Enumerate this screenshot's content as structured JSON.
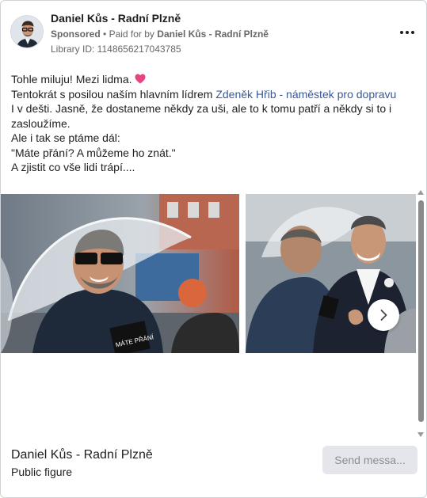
{
  "ad": {
    "advertiser_name": "Daniel Kůs - Radní Plzně",
    "sponsored_label": "Sponsored",
    "separator": "•",
    "paid_for_prefix": "Paid for by",
    "paid_for_name": "Daniel Kůs - Radní Plzně",
    "library_id": "Library ID: 1148656217043785",
    "more_icon": "more-options-icon"
  },
  "body": {
    "line1": "Tohle miluju! Mezi lidma.",
    "line2_prefix": "Tentokrát s posilou naším hlavním lídrem",
    "line2_link": "Zdeněk Hřib - náměstek pro dopravu",
    "line3": "I v dešti. Jasně, že dostaneme někdy za uši, ale to k tomu patří a někdy si to i",
    "line4": "zasloužíme.",
    "line5": "Ale i tak se ptáme dál:",
    "line6": "\"Máte přání? A můžeme ho znát.\"",
    "line7": "A zjistit co vše lidi trápí...."
  },
  "carousel": {
    "slide1_sign": "MÁTE PŘÁNÍ",
    "next_icon": "chevron-right-icon"
  },
  "footer": {
    "page_name": "Daniel Kůs - Radní Plzně",
    "page_category": "Public figure",
    "send_button": "Send messa..."
  },
  "colors": {
    "link": "#385898",
    "heart": "#e64582",
    "send_button_bg": "#e4e6eb",
    "secondary_text": "#65676b"
  }
}
